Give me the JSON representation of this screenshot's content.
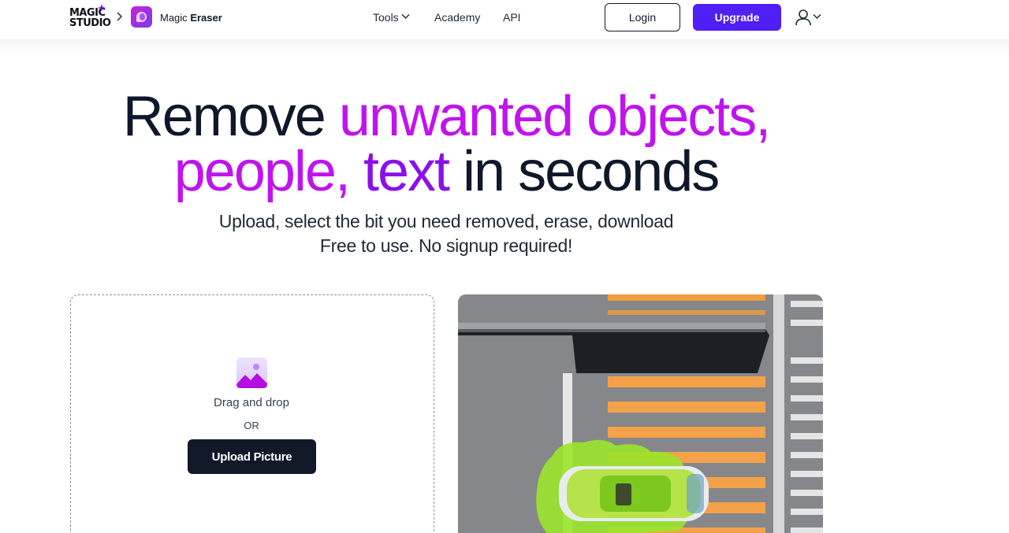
{
  "header": {
    "logo_line1": "MAGIC",
    "logo_line2": "STUDIO",
    "app_name_regular": "Magic",
    "app_name_bold": "Eraser",
    "nav": {
      "tools": "Tools",
      "academy": "Academy",
      "api": "API"
    },
    "login_label": "Login",
    "upgrade_label": "Upgrade"
  },
  "hero": {
    "line1_dark": "Remove",
    "line1_accent": "unwanted objects,",
    "line2_accent1": "people,",
    "line2_accent2": "text",
    "line2_dark": "in seconds",
    "subtitle1": "Upload, select the bit you need removed, erase, download",
    "subtitle2": "Free to use. No signup required!"
  },
  "upload": {
    "drag_text": "Drag and drop",
    "or_text": "OR",
    "button_label": "Upload Picture"
  },
  "icons": {
    "logo_spark": "sparkle-icon",
    "breadcrumb": "chevron-right-icon",
    "app": "magic-eraser-app-icon",
    "tools_dropdown": "chevron-down-icon",
    "user": "user-icon",
    "upload": "image-icon"
  },
  "colors": {
    "accent_pink": "#c013f0",
    "accent_purple": "#8b10e8",
    "upgrade_button": "#4f1ff5",
    "dark_button": "#111827",
    "eraser_highlight": "#9be52b"
  }
}
